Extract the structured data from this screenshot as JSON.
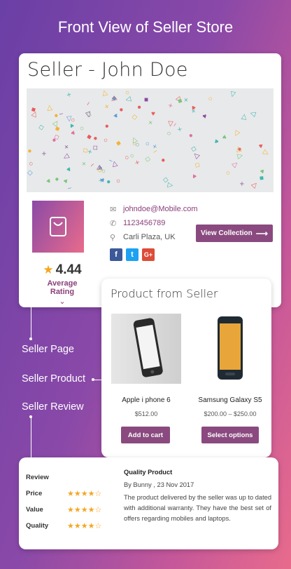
{
  "page_title": "Front View of Seller Store",
  "seller": {
    "name": "Seller - John Doe",
    "rating_value": "4.44",
    "rating_label": "Average Rating",
    "email": "johndoe@Mobile.com",
    "phone": "1123456789",
    "location": "Carli Plaza, UK",
    "view_collection_label": "View Collection",
    "socials": [
      "f",
      "t",
      "G+"
    ]
  },
  "products": {
    "title": "Product from Seller",
    "items": [
      {
        "name": "Apple i phone 6",
        "price": "$512.00",
        "button": "Add to cart"
      },
      {
        "name": "Samsung Galaxy S5",
        "price": "$200.00 – $250.00",
        "button": "Select options"
      }
    ]
  },
  "labels": {
    "seller_page": "Seller Page",
    "seller_product": "Seller Product",
    "seller_review": "Seller Review"
  },
  "review": {
    "header": "Review",
    "criteria": [
      {
        "label": "Price",
        "stars": "★★★★☆"
      },
      {
        "label": "Value",
        "stars": "★★★★☆"
      },
      {
        "label": "Quality",
        "stars": "★★★★☆"
      }
    ],
    "title": "Quality Product",
    "meta": "By Bunny , 23 Nov 2017",
    "text": "The product delivered by the seller was up to dated with additional warranty. They have the best set of offers regarding mobiles and laptops."
  },
  "colors": {
    "accent": "#8a4a7f",
    "star": "#f5a623",
    "facebook": "#3b5998",
    "twitter": "#1da1f2",
    "google": "#dd4b39"
  }
}
